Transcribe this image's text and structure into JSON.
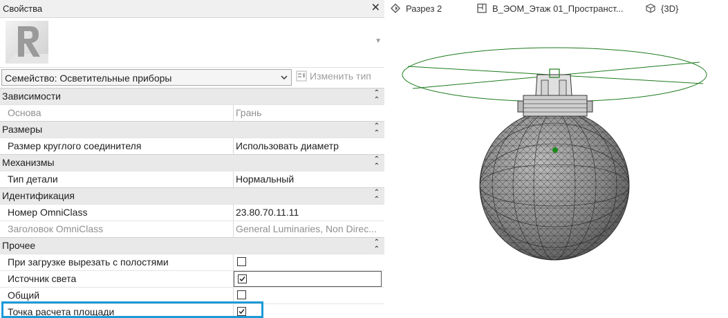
{
  "panel": {
    "title": "Свойства",
    "close_glyph": "✕",
    "family_selector": "Семейство: Осветительные приборы",
    "edit_type_label": "Изменить тип",
    "collapse_glyph": "⌃"
  },
  "groups": [
    {
      "label": "Зависимости",
      "rows": [
        {
          "name": "Основа",
          "value": "Грань",
          "disabled": true
        }
      ]
    },
    {
      "label": "Размеры",
      "rows": [
        {
          "name": "Размер круглого соединителя",
          "value": "Использовать диаметр"
        }
      ]
    },
    {
      "label": "Механизмы",
      "rows": [
        {
          "name": "Тип детали",
          "value": "Нормальный"
        }
      ]
    },
    {
      "label": "Идентификация",
      "rows": [
        {
          "name": "Номер OmniClass",
          "value": "23.80.70.11.11"
        },
        {
          "name": "Заголовок OmniClass",
          "value": "General Luminaries, Non Direc...",
          "disabled": true
        }
      ]
    },
    {
      "label": "Прочее",
      "rows": [
        {
          "name": "При загрузке вырезать с полостями",
          "checked": false
        },
        {
          "name": "Источник света",
          "checked": true
        },
        {
          "name": "Общий",
          "checked": false
        },
        {
          "name": "Точка расчета площади",
          "checked": true
        }
      ]
    }
  ],
  "tabs": [
    {
      "label": "Разрез 2",
      "icon": "section-view-icon"
    },
    {
      "label": "В_ЭОМ_Этаж 01_Пространст...",
      "icon": "floor-plan-icon"
    },
    {
      "label": "{3D}",
      "icon": "3d-view-icon"
    }
  ],
  "colors": {
    "highlight": "#1a9ad9",
    "light_source_ring": "#1a7a1a",
    "sphere": "#8a8a8a"
  }
}
